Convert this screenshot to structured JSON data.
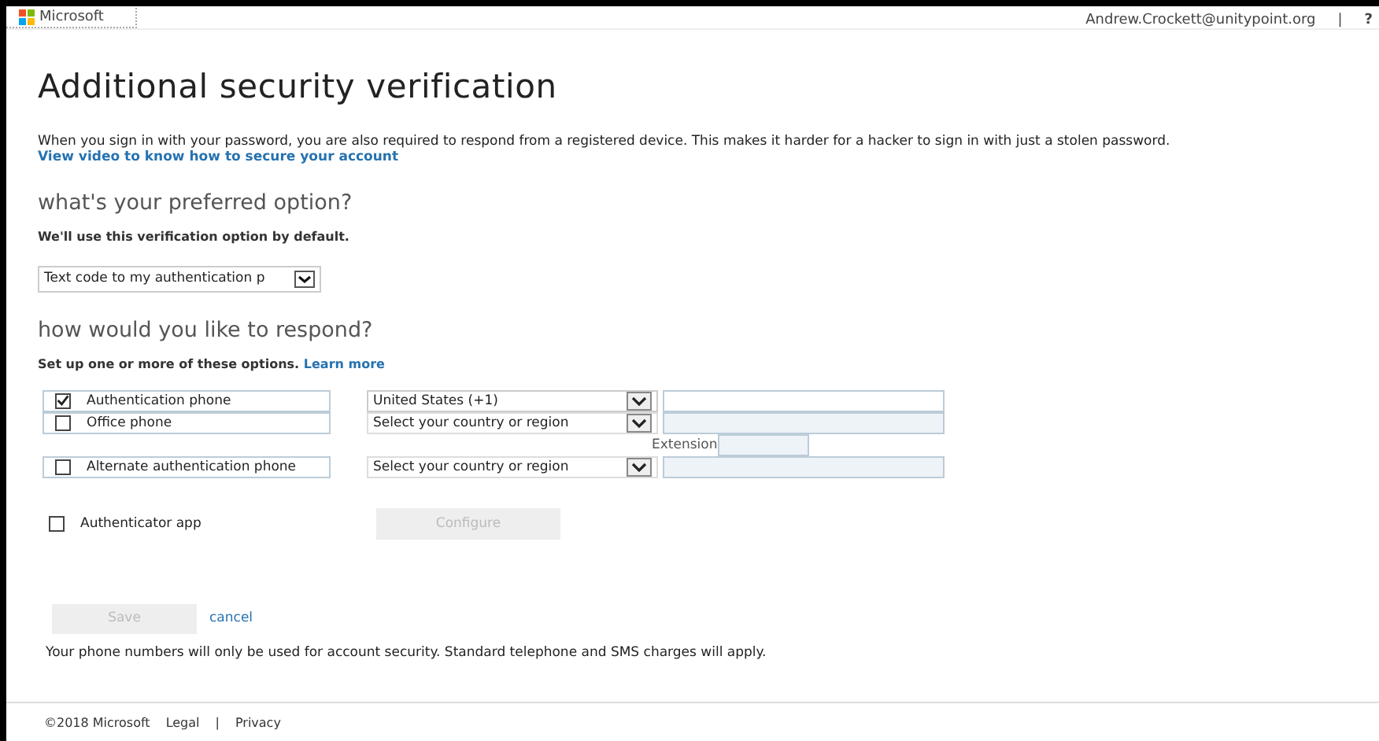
{
  "header": {
    "brand": "Microsoft",
    "user": "Andrew.Crockett@unitypoint.org",
    "separator": "|",
    "help": "?"
  },
  "title": "Additional security verification",
  "intro": "When you sign in with your password, you are also required to respond from a registered device. This makes it harder for a hacker to sign in with just a stolen password.",
  "intro_link": "View video to know how to secure your account",
  "preferred": {
    "heading": "what's your preferred option?",
    "note": "We'll use this verification option by default.",
    "value": "Text code to my authentication p"
  },
  "respond": {
    "heading": "how would you like to respond?",
    "note": "Set up one or more of these options.",
    "link": "Learn more"
  },
  "options": [
    {
      "kind": "phone",
      "label": "Authentication phone",
      "checked": true,
      "country": "United States (+1)",
      "disabled": false
    },
    {
      "kind": "phone",
      "label": "Office phone",
      "checked": false,
      "country": "Select your country or region",
      "disabled": true,
      "extension_label": "Extension"
    },
    {
      "kind": "phone",
      "label": "Alternate authentication phone",
      "checked": false,
      "country": "Select your country or region",
      "disabled": true
    },
    {
      "kind": "app",
      "label": "Authenticator app",
      "checked": false,
      "button": "Configure",
      "disabled": true
    }
  ],
  "actions": {
    "save": "Save",
    "save_disabled": true,
    "cancel": "cancel"
  },
  "disclaimer": "Your phone numbers will only be used for account security. Standard telephone and SMS charges will apply.",
  "footer": {
    "copyright": "©2018 Microsoft",
    "links": [
      "Legal",
      "Privacy"
    ],
    "separator": "|"
  }
}
